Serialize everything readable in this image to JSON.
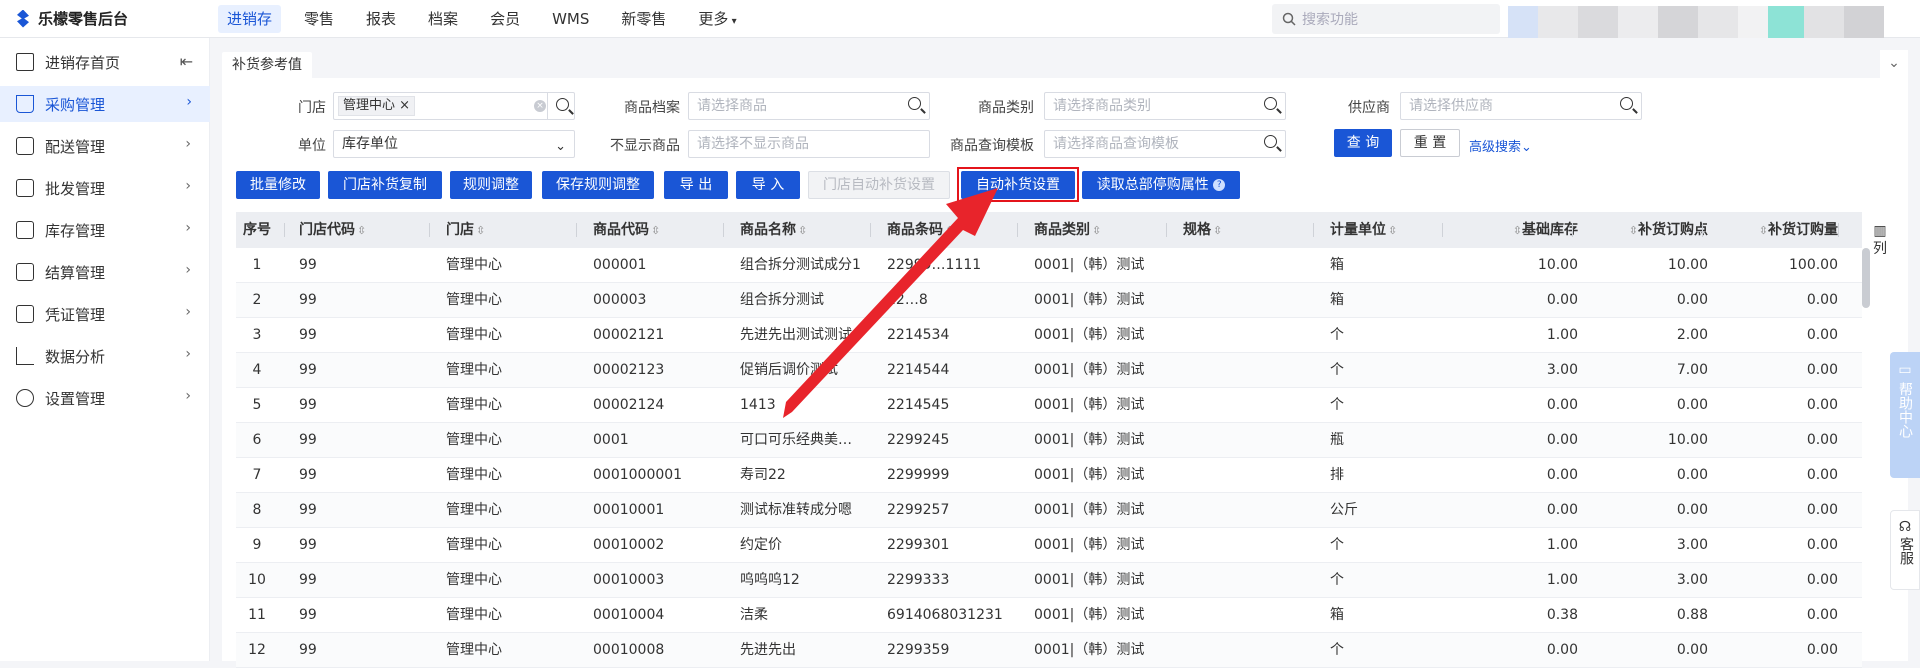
{
  "app": {
    "title": "乐檬零售后台"
  },
  "nav": {
    "items": [
      "进销存",
      "零售",
      "报表",
      "档案",
      "会员",
      "WMS",
      "新零售",
      "更多"
    ],
    "active": "进销存"
  },
  "top_search": {
    "placeholder": "搜索功能"
  },
  "sidebar": {
    "items": [
      {
        "label": "进销存首页",
        "icon": "home-icon"
      },
      {
        "label": "采购管理",
        "icon": "cart-icon",
        "active": true
      },
      {
        "label": "配送管理",
        "icon": "delivery-icon"
      },
      {
        "label": "批发管理",
        "icon": "wholesale-icon"
      },
      {
        "label": "库存管理",
        "icon": "inventory-icon"
      },
      {
        "label": "结算管理",
        "icon": "settlement-icon"
      },
      {
        "label": "凭证管理",
        "icon": "voucher-icon"
      },
      {
        "label": "数据分析",
        "icon": "chart-icon"
      },
      {
        "label": "设置管理",
        "icon": "settings-icon"
      }
    ]
  },
  "tab": {
    "label": "补货参考值"
  },
  "filters": {
    "store_label": "门店",
    "store_tag": "管理中心",
    "product_label": "商品档案",
    "product_placeholder": "请选择商品",
    "category_label": "商品类别",
    "category_placeholder": "请选择商品类别",
    "supplier_label": "供应商",
    "supplier_placeholder": "请选择供应商",
    "unit_label": "单位",
    "unit_value": "库存单位",
    "hidden_label": "不显示商品",
    "hidden_placeholder": "请选择不显示商品",
    "template_label": "商品查询模板",
    "template_placeholder": "请选择商品查询模板",
    "query_btn": "查 询",
    "reset_btn": "重 置",
    "advanced": "高级搜索"
  },
  "actions": {
    "batch_edit": "批量修改",
    "store_copy": "门店补货复制",
    "rule_adjust": "规则调整",
    "save_rule": "保存规则调整",
    "export": "导 出",
    "import": "导 入",
    "store_auto": "门店自动补货设置",
    "auto_setting": "自动补货设置",
    "read_hq": "读取总部停购属性"
  },
  "table": {
    "columns": [
      "序号",
      "门店代码",
      "门店",
      "商品代码",
      "商品名称",
      "商品条码",
      "商品类别",
      "规格",
      "计量单位",
      "基础库存",
      "补货订购点",
      "补货订购量"
    ],
    "col_settings": "列",
    "rows": [
      [
        "1",
        "99",
        "管理中心",
        "000001",
        "组合拆分测试成分1",
        "22999…1111",
        "0001|（韩）测试",
        "",
        "箱",
        "10.00",
        "10.00",
        "100.00"
      ],
      [
        "2",
        "99",
        "管理中心",
        "000003",
        "组合拆分测试",
        "22…8",
        "0001|（韩）测试",
        "",
        "箱",
        "0.00",
        "0.00",
        "0.00"
      ],
      [
        "3",
        "99",
        "管理中心",
        "00002121",
        "先进先出测试测试",
        "2214534",
        "0001|（韩）测试",
        "",
        "个",
        "1.00",
        "2.00",
        "0.00"
      ],
      [
        "4",
        "99",
        "管理中心",
        "00002123",
        "促销后调价测试",
        "2214544",
        "0001|（韩）测试",
        "",
        "个",
        "3.00",
        "7.00",
        "0.00"
      ],
      [
        "5",
        "99",
        "管理中心",
        "00002124",
        "1413",
        "2214545",
        "0001|（韩）测试",
        "",
        "个",
        "0.00",
        "0.00",
        "0.00"
      ],
      [
        "6",
        "99",
        "管理中心",
        "0001",
        "可口可乐经典美…",
        "2299245",
        "0001|（韩）测试",
        "",
        "瓶",
        "0.00",
        "10.00",
        "0.00"
      ],
      [
        "7",
        "99",
        "管理中心",
        "0001000001",
        "寿司22",
        "2299999",
        "0001|（韩）测试",
        "",
        "排",
        "0.00",
        "0.00",
        "0.00"
      ],
      [
        "8",
        "99",
        "管理中心",
        "00010001",
        "测试标准转成分嗯",
        "2299257",
        "0001|（韩）测试",
        "",
        "公斤",
        "0.00",
        "0.00",
        "0.00"
      ],
      [
        "9",
        "99",
        "管理中心",
        "00010002",
        "约定价",
        "2299301",
        "0001|（韩）测试",
        "",
        "个",
        "1.00",
        "3.00",
        "0.00"
      ],
      [
        "10",
        "99",
        "管理中心",
        "00010003",
        "呜呜呜12",
        "2299333",
        "0001|（韩）测试",
        "",
        "个",
        "1.00",
        "3.00",
        "0.00"
      ],
      [
        "11",
        "99",
        "管理中心",
        "00010004",
        "洁柔",
        "6914068031231",
        "0001|（韩）测试",
        "",
        "箱",
        "0.38",
        "0.88",
        "0.00"
      ],
      [
        "12",
        "99",
        "管理中心",
        "00010008",
        "先进先出",
        "2299359",
        "0001|（韩）测试",
        "",
        "个",
        "0.00",
        "0.00",
        "0.00"
      ]
    ]
  },
  "floats": {
    "help": "帮助中心",
    "service": "客服"
  },
  "colors": {
    "accent": "#1a56d6",
    "highlight": "#e4141b",
    "arrow": "#e8242b"
  }
}
